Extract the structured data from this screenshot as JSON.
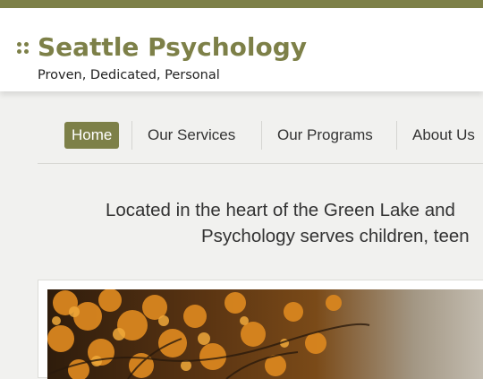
{
  "header": {
    "title": "Seattle Psychology",
    "tagline": "Proven, Dedicated, Personal"
  },
  "nav": {
    "items": [
      {
        "label": "Home",
        "active": true
      },
      {
        "label": "Our Services",
        "active": false
      },
      {
        "label": "Our Programs",
        "active": false
      },
      {
        "label": "About Us",
        "active": false
      }
    ]
  },
  "intro": {
    "line1": "Located in the heart of the Green Lake and",
    "line2": "Psychology serves children, teen"
  },
  "colors": {
    "accent": "#7d8048",
    "background": "#f1f1ef"
  }
}
